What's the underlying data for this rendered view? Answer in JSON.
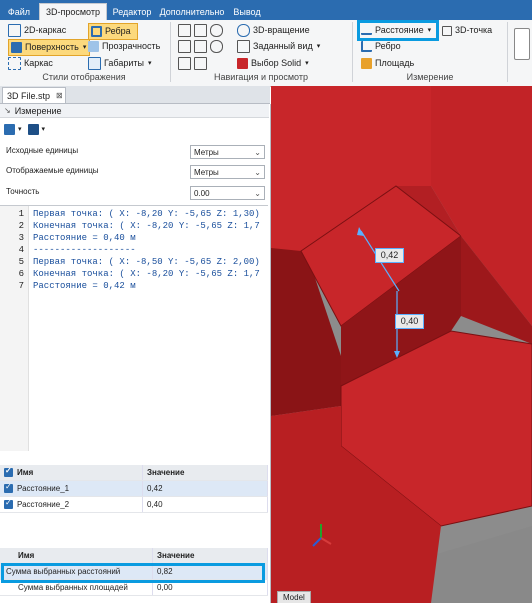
{
  "tabs": {
    "file": "Файл",
    "view3d": "3D-просмотр",
    "editor": "Редактор",
    "additional": "Дополнительно",
    "output": "Вывод"
  },
  "ribbon": {
    "display_styles": {
      "wireframe2d": "2D-каркас",
      "edges": "Ребра",
      "surfaces": "Поверхность",
      "transparency": "Прозрачность",
      "wireframe": "Каркас",
      "dimensions": "Габариты",
      "label": "Стили отображения"
    },
    "navigation": {
      "rotate3d": "3D-вращение",
      "preset_view": "Заданный вид",
      "select_solid": "Выбор Solid",
      "label": "Навигация и просмотр"
    },
    "measurement": {
      "distance": "Расстояние",
      "point3d": "3D-точка",
      "edge": "Ребро",
      "area": "Площадь",
      "label": "Измерение"
    }
  },
  "document_tab": "3D File.stp",
  "panel": {
    "title": "Измерение",
    "source_units_label": "Исходные единицы",
    "source_units_value": "Метры",
    "display_units_label": "Отображаемые единицы",
    "display_units_value": "Метры",
    "precision_label": "Точность",
    "precision_value": "0.00"
  },
  "log_lines": [
    {
      "n": "1",
      "text": "Первая точка: ( X: -8,20 Y: -5,65 Z: 1,30)"
    },
    {
      "n": "2",
      "text": "Конечная точка: ( X: -8,20 Y: -5,65 Z: 1,7"
    },
    {
      "n": "3",
      "text": "Расстояние = 0,40 м"
    },
    {
      "n": "4",
      "text": "-------------------"
    },
    {
      "n": "5",
      "text": "Первая точка: ( X: -8,50 Y: -5,65 Z: 2,00)"
    },
    {
      "n": "6",
      "text": "Конечная точка: ( X: -8,20 Y: -5,65 Z: 1,7"
    },
    {
      "n": "7",
      "text": "Расстояние = 0,42 м"
    }
  ],
  "results_table": {
    "col_name": "Имя",
    "col_value": "Значение",
    "rows": [
      {
        "name": "Расстояние_1",
        "value": "0,42"
      },
      {
        "name": "Расстояние_2",
        "value": "0,40"
      }
    ]
  },
  "summary_table": {
    "col_name": "Имя",
    "col_value": "Значение",
    "rows": [
      {
        "name": "Сумма выбранных расстояний",
        "value": "0,82"
      },
      {
        "name": "Сумма выбранных площадей",
        "value": "0,00"
      }
    ]
  },
  "viewport": {
    "label_upper": "0,42",
    "label_lower": "0,40",
    "model_tab": "Model"
  },
  "colors": {
    "accent": "#2b6cb0",
    "highlight": "#0a9be0",
    "model_red": "#c8262a"
  }
}
